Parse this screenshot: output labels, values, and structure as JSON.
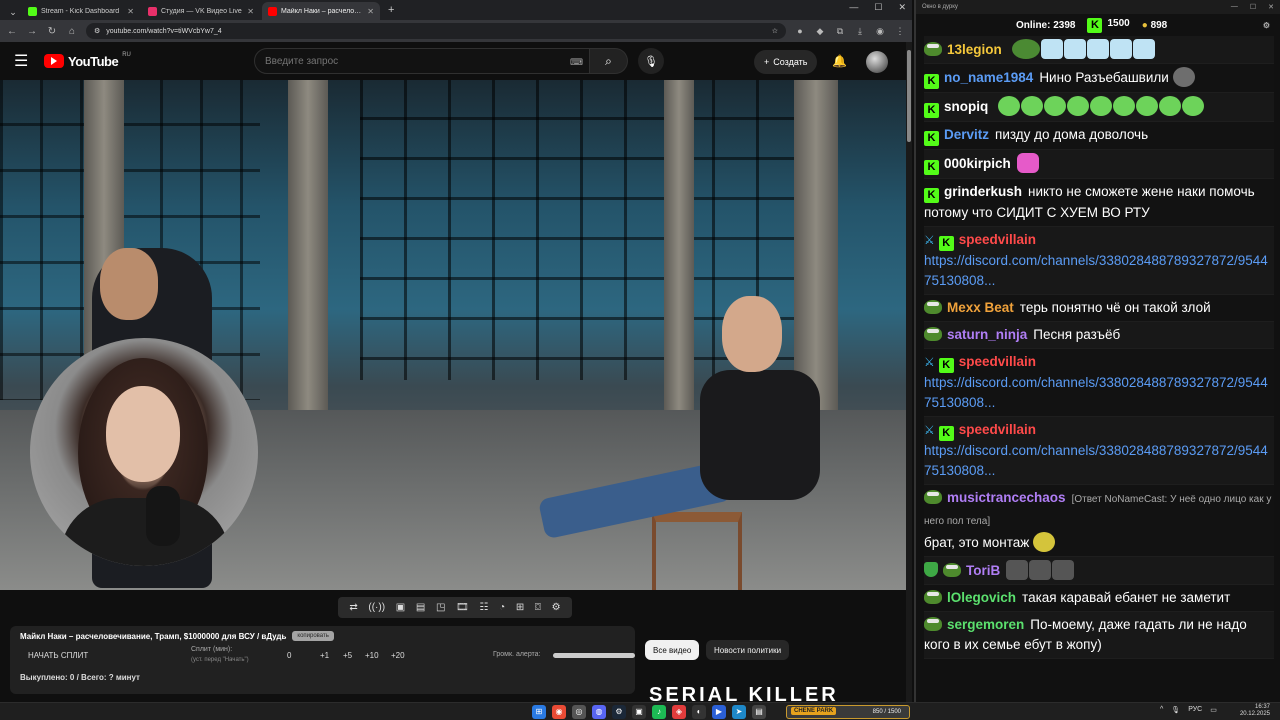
{
  "browser": {
    "tabs": [
      {
        "label": "Stream - Kick Dashboard",
        "color": "#53fc18",
        "active": false
      },
      {
        "label": "Студия — VK Видео Live",
        "color": "#e8306a",
        "active": false
      },
      {
        "label": "Майкл Наки – расчеловечиван",
        "color": "#ff0000",
        "active": true
      }
    ],
    "url": "youtube.com/watch?v=tiWVcbYw7_4"
  },
  "youtube": {
    "logo_text": "YouTube",
    "region": "RU",
    "search_placeholder": "Введите запрос",
    "create_label": "Создать"
  },
  "split_panel": {
    "title": "Майкл Наки – расчеловечивание, Трамп, $1000000 для ВСУ / вДудь",
    "copy_label": "копировать",
    "start_label": "НАЧАТЬ СПЛИТ",
    "split_label": "Сплит (мин):",
    "split_sub": "(уст. перед \"Начать\")",
    "split_value": "0",
    "increments": [
      "+1",
      "+5",
      "+10",
      "+20"
    ],
    "volume_label": "Громк. алерта:",
    "footer": "Выкуплено: 0 / Всего: ? минут"
  },
  "chips": {
    "all_videos": "Все видео",
    "news": "Новости политики"
  },
  "promo_text": "SERIAL KILLER",
  "chat": {
    "window_title": "Окно в дурку",
    "online_label": "Online:",
    "online_count": "2398",
    "kick_count": "1500",
    "coin_count": "898",
    "messages": [
      {
        "user": "13legion",
        "color": "#f5c83b",
        "text": "",
        "link": ""
      },
      {
        "user": "no_name1984",
        "color": "#5b9cf5",
        "text": "Нино Разъебашвили",
        "link": ""
      },
      {
        "user": "snopiq",
        "color": "#ffffff",
        "text": "",
        "link": ""
      },
      {
        "user": "Dervitz",
        "color": "#5b9cf5",
        "text": "пизду до дома доволочь",
        "link": ""
      },
      {
        "user": "000kirpich",
        "color": "#ffffff",
        "text": "",
        "link": ""
      },
      {
        "user": "grinderkush",
        "color": "#ffffff",
        "text": "никто не сможете жене наки помочь потому что СИДИТ С ХУЕМ ВО РТУ",
        "link": ""
      },
      {
        "user": "speedvillain",
        "color": "#ff4a4a",
        "text": "",
        "link": "https://discord.com/channels/338028488789327872/954475130808..."
      },
      {
        "user": "Mexx Beat",
        "color": "#f0a23b",
        "text": "терь понятно чё он такой злой",
        "link": ""
      },
      {
        "user": "saturn_ninja",
        "color": "#b07ef5",
        "text": "Песня разъёб",
        "link": ""
      },
      {
        "user": "speedvillain",
        "color": "#ff4a4a",
        "text": "",
        "link": "https://discord.com/channels/338028488789327872/954475130808..."
      },
      {
        "user": "speedvillain",
        "color": "#ff4a4a",
        "text": "",
        "link": "https://discord.com/channels/338028488789327872/954475130808..."
      },
      {
        "user": "musictrancechaos",
        "color": "#b07ef5",
        "reply": "[Ответ NoNameCast: У неё одно лицо как у него пол тела]",
        "text": "брат, это монтаж",
        "link": ""
      },
      {
        "user": "ToriB",
        "color": "#b07ef5",
        "text": "",
        "link": ""
      },
      {
        "user": "lOlegovich",
        "color": "#5be06e",
        "text": "такая каравай ебанет не заметит",
        "link": ""
      },
      {
        "user": "sergemoren",
        "color": "#5be06e",
        "text": "По-моему, даже гадать ли не надо кого в их семье ебут в жопу)",
        "link": ""
      }
    ]
  },
  "taskbar": {
    "game_label": "CHENE PARK",
    "game_progress": "850 / 1500",
    "lang": "РУС",
    "time": "16:37",
    "date": "20.12.2025"
  }
}
